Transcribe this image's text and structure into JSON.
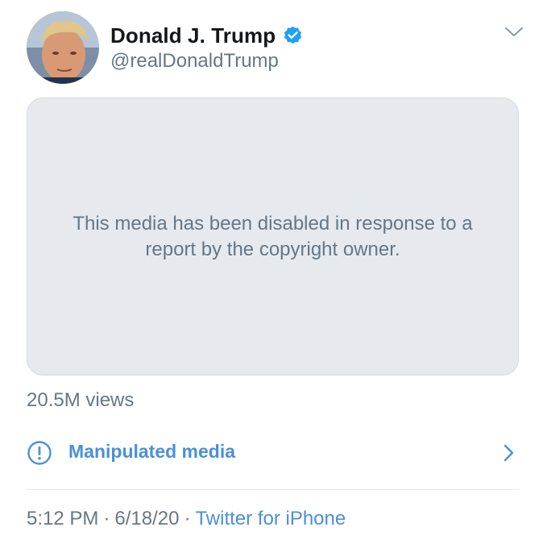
{
  "author": {
    "display_name": "Donald J. Trump",
    "handle": "@realDonaldTrump",
    "verified": true,
    "avatar_icon": "profile-photo",
    "verified_icon": "verified-badge-icon"
  },
  "media": {
    "notice": "This media has been disabled in response to a report by the copyright owner."
  },
  "stats": {
    "views": "20.5M views"
  },
  "label": {
    "text": "Manipulated media",
    "icon": "exclamation-circle-icon",
    "chevron_icon": "chevron-right-icon"
  },
  "meta": {
    "time": "5:12 PM",
    "separator": "·",
    "date": "6/18/20",
    "source": "Twitter for iPhone"
  },
  "colors": {
    "accent": "#4a90d9",
    "verified": "#1da1f2",
    "secondary_text": "#657786",
    "media_bg": "#e6e9ee"
  }
}
